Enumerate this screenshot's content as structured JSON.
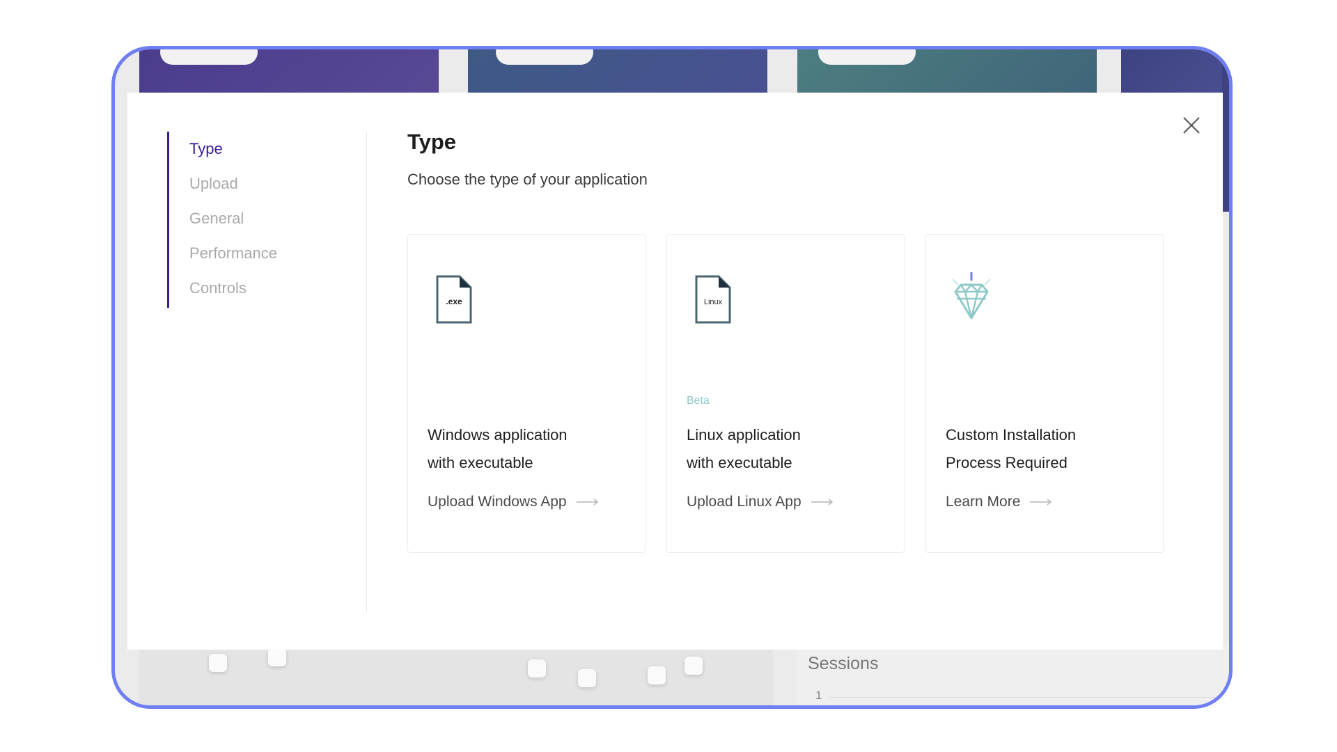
{
  "modal": {
    "steps": [
      {
        "label": "Type",
        "active": true
      },
      {
        "label": "Upload",
        "active": false
      },
      {
        "label": "General",
        "active": false
      },
      {
        "label": "Performance",
        "active": false
      },
      {
        "label": "Controls",
        "active": false
      }
    ],
    "heading": "Type",
    "subheading": "Choose the type of your application",
    "cards": [
      {
        "icon": "exe-file-icon",
        "icon_text": ".exe",
        "badge": "",
        "title_line1": "Windows application",
        "title_line2": "with executable",
        "link": "Upload Windows App"
      },
      {
        "icon": "linux-file-icon",
        "icon_text": "Linux",
        "badge": "Beta",
        "title_line1": "Linux application",
        "title_line2": "with executable",
        "link": "Upload Linux App"
      },
      {
        "icon": "diamond-icon",
        "icon_text": "",
        "badge": "",
        "title_line1": "Custom Installation",
        "title_line2": "Process Required",
        "link": "Learn More"
      }
    ]
  },
  "background": {
    "sessions_label": "Sessions",
    "sessions_tick": "1"
  },
  "colors": {
    "frame": "#6f7ff2",
    "accent": "#3b1a9c",
    "beta": "#8ec9c8",
    "icon_stroke": "#4a6670"
  }
}
